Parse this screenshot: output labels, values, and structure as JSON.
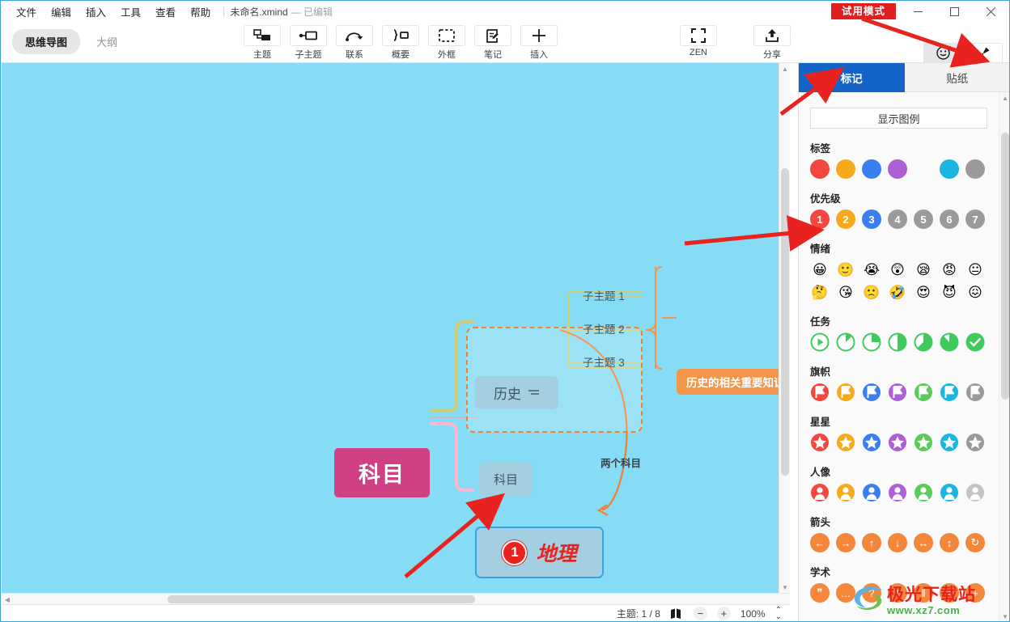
{
  "window": {
    "title": "未命名.xmind",
    "edited_state": "— 已编辑",
    "trial_badge": "试用模式",
    "minimize": "—",
    "maximize": "▢",
    "close": "✕"
  },
  "menubar": {
    "items": [
      {
        "label": "文件",
        "name": "menu-file"
      },
      {
        "label": "编辑",
        "name": "menu-edit"
      },
      {
        "label": "插入",
        "name": "menu-insert"
      },
      {
        "label": "工具",
        "name": "menu-tools"
      },
      {
        "label": "查看",
        "name": "menu-view"
      },
      {
        "label": "帮助",
        "name": "menu-help"
      }
    ]
  },
  "view_tabs": [
    {
      "label": "思维导图",
      "active": true
    },
    {
      "label": "大纲",
      "active": false
    }
  ],
  "toolbar": {
    "buttons": [
      {
        "label": "主题",
        "icon": "topic-icon"
      },
      {
        "label": "子主题",
        "icon": "subtopic-icon"
      },
      {
        "label": "联系",
        "icon": "relationship-icon"
      },
      {
        "label": "概要",
        "icon": "summary-icon"
      },
      {
        "label": "外框",
        "icon": "boundary-icon"
      },
      {
        "label": "笔记",
        "icon": "note-icon"
      },
      {
        "label": "插入",
        "icon": "plus-icon"
      }
    ],
    "zen": {
      "label": "ZEN",
      "icon": "fullscreen-icon"
    },
    "share": {
      "label": "分享",
      "icon": "share-icon"
    }
  },
  "panel_toggle": [
    {
      "label": "图标",
      "icon": "smiley-icon",
      "active": true
    },
    {
      "label": "格式",
      "icon": "brush-icon",
      "active": false
    }
  ],
  "canvas": {
    "root": "科目",
    "history_node": "历史",
    "history_note_icon": "note-lines-icon",
    "subtopics": [
      "子主题 1",
      "子主题 2",
      "子主题 3"
    ],
    "kemu_node": "科目",
    "geo_node": "地理",
    "geo_priority": "1",
    "callout": "历史的相关重要知识",
    "relationship_label": "两个科目"
  },
  "statusbar": {
    "topic_count": "主题: 1 / 8",
    "map_icon": "map-icon",
    "zoom_out": "−",
    "zoom_in": "+",
    "zoom_level": "100%",
    "zoom_stepper": "⌃⌄"
  },
  "right_panel": {
    "tabs": [
      {
        "label": "标记",
        "active": true
      },
      {
        "label": "贴纸",
        "active": false
      }
    ],
    "legend_button": "显示图例",
    "sections": [
      {
        "title": "标签",
        "kind": "dot",
        "items": [
          {
            "name": "label-red",
            "color": "#f4473f",
            "glyph": ""
          },
          {
            "name": "label-orange",
            "color": "#f5a91b",
            "glyph": ""
          },
          {
            "name": "label-blue",
            "color": "#3a7ff0",
            "glyph": ""
          },
          {
            "name": "label-purple",
            "color": "#ad5fd6",
            "glyph": ""
          },
          {
            "name": "label-green",
            "color": "#3cc койот",
            "glyph": ""
          },
          {
            "name": "label-cyan",
            "color": "#1ab6e0",
            "glyph": ""
          },
          {
            "name": "label-gray",
            "color": "#9a9a9a",
            "glyph": ""
          }
        ]
      },
      {
        "title": "优先级",
        "kind": "num",
        "items": [
          {
            "name": "priority-1",
            "color": "#f4473f",
            "glyph": "1"
          },
          {
            "name": "priority-2",
            "color": "#f5a91b",
            "glyph": "2"
          },
          {
            "name": "priority-3",
            "color": "#3a7ff0",
            "glyph": "3"
          },
          {
            "name": "priority-4",
            "color": "#9a9a9a",
            "glyph": "4"
          },
          {
            "name": "priority-5",
            "color": "#9a9a9a",
            "glyph": "5"
          },
          {
            "name": "priority-6",
            "color": "#9a9a9a",
            "glyph": "6"
          },
          {
            "name": "priority-7",
            "color": "#9a9a9a",
            "glyph": "7"
          }
        ]
      },
      {
        "title": "情绪",
        "kind": "emoji",
        "items": [
          {
            "name": "smiley-laugh",
            "color": "transparent",
            "glyph": "😀"
          },
          {
            "name": "smiley-smile",
            "color": "transparent",
            "glyph": "🙂"
          },
          {
            "name": "smiley-cry",
            "color": "transparent",
            "glyph": "😭"
          },
          {
            "name": "smiley-surprise",
            "color": "transparent",
            "glyph": "😲"
          },
          {
            "name": "smiley-sleepy",
            "color": "transparent",
            "glyph": "😪"
          },
          {
            "name": "smiley-angry",
            "color": "transparent",
            "glyph": "😡"
          },
          {
            "name": "smiley-neutral",
            "color": "transparent",
            "glyph": "😐"
          },
          {
            "name": "smiley-thinking",
            "color": "transparent",
            "glyph": "🤔"
          },
          {
            "name": "smiley-kiss",
            "color": "transparent",
            "glyph": "😘"
          },
          {
            "name": "smiley-sad",
            "color": "transparent",
            "glyph": "🙁"
          },
          {
            "name": "smiley-rofl",
            "color": "transparent",
            "glyph": "🤣"
          },
          {
            "name": "smiley-love",
            "color": "transparent",
            "glyph": "😍"
          },
          {
            "name": "smiley-devil",
            "color": "transparent",
            "glyph": "😈"
          },
          {
            "name": "smiley-persevere",
            "color": "transparent",
            "glyph": "😖"
          }
        ]
      },
      {
        "title": "任务",
        "kind": "task",
        "items": [
          {
            "name": "task-start",
            "color": "#3ecb5b",
            "pct": 0
          },
          {
            "name": "task-one-eighth",
            "color": "#3ecb5b",
            "pct": 13
          },
          {
            "name": "task-quarter",
            "color": "#3ecb5b",
            "pct": 25
          },
          {
            "name": "task-half",
            "color": "#3ecb5b",
            "pct": 50
          },
          {
            "name": "task-five-eighth",
            "color": "#3ecb5b",
            "pct": 63
          },
          {
            "name": "task-seven-eighth",
            "color": "#3ecb5b",
            "pct": 88
          },
          {
            "name": "task-done",
            "color": "#3ecb5b",
            "pct": 100
          }
        ]
      },
      {
        "title": "旗帜",
        "kind": "flag",
        "items": [
          {
            "name": "flag-red",
            "color": "#f4473f",
            "glyph": "⚑"
          },
          {
            "name": "flag-orange",
            "color": "#f5a91b",
            "glyph": "⚑"
          },
          {
            "name": "flag-blue",
            "color": "#3a7ff0",
            "glyph": "⚑"
          },
          {
            "name": "flag-purple",
            "color": "#ad5fd6",
            "glyph": "⚑"
          },
          {
            "name": "flag-green",
            "color": "#5ccb5b",
            "glyph": "⚑"
          },
          {
            "name": "flag-cyan",
            "color": "#1ab6e0",
            "glyph": "⚑"
          },
          {
            "name": "flag-gray",
            "color": "#9a9a9a",
            "glyph": "⚑"
          }
        ]
      },
      {
        "title": "星星",
        "kind": "star",
        "items": [
          {
            "name": "star-red",
            "color": "#f4473f",
            "glyph": "★"
          },
          {
            "name": "star-orange",
            "color": "#f5a91b",
            "glyph": "★"
          },
          {
            "name": "star-blue",
            "color": "#3a7ff0",
            "glyph": "★"
          },
          {
            "name": "star-purple",
            "color": "#ad5fd6",
            "glyph": "★"
          },
          {
            "name": "star-green",
            "color": "#5ccb5b",
            "glyph": "★"
          },
          {
            "name": "star-cyan",
            "color": "#1ab6e0",
            "glyph": "★"
          },
          {
            "name": "star-gray",
            "color": "#9a9a9a",
            "glyph": "★"
          }
        ]
      },
      {
        "title": "人像",
        "kind": "person",
        "items": [
          {
            "name": "person-red",
            "color": "#f4473f",
            "glyph": "👤"
          },
          {
            "name": "person-orange",
            "color": "#f5a91b",
            "glyph": "👤"
          },
          {
            "name": "person-blue",
            "color": "#3a7ff0",
            "glyph": "👤"
          },
          {
            "name": "person-purple",
            "color": "#ad5fd6",
            "glyph": "👤"
          },
          {
            "name": "person-green",
            "color": "#5ccb5b",
            "glyph": "👤"
          },
          {
            "name": "person-cyan",
            "color": "#1ab6e0",
            "glyph": "👤"
          },
          {
            "name": "person-gray",
            "color": "#c4c4c4",
            "glyph": "👤"
          }
        ]
      },
      {
        "title": "箭头",
        "kind": "arrow",
        "items": [
          {
            "name": "arrow-left",
            "color": "#f4873b",
            "glyph": "←"
          },
          {
            "name": "arrow-right",
            "color": "#f4873b",
            "glyph": "→"
          },
          {
            "name": "arrow-up",
            "color": "#f4873b",
            "glyph": "↑"
          },
          {
            "name": "arrow-down",
            "color": "#f4873b",
            "glyph": "↓"
          },
          {
            "name": "arrow-left-right",
            "color": "#f4873b",
            "glyph": "↔"
          },
          {
            "name": "arrow-up-down",
            "color": "#f4873b",
            "glyph": "↕"
          },
          {
            "name": "arrow-refresh",
            "color": "#f4873b",
            "glyph": "↻"
          }
        ]
      },
      {
        "title": "学术",
        "kind": "acad",
        "items": [
          {
            "name": "acad-quote",
            "color": "#f4873b",
            "glyph": "❞"
          },
          {
            "name": "acad-ellipsis",
            "color": "#f4873b",
            "glyph": "…"
          },
          {
            "name": "acad-question",
            "color": "#f4873b",
            "glyph": "?"
          },
          {
            "name": "acad-exclamation",
            "color": "#f4873b",
            "glyph": "!"
          },
          {
            "name": "acad-pause",
            "color": "#f4873b",
            "glyph": "‖"
          },
          {
            "name": "acad-info",
            "color": "#f4873b",
            "glyph": "i"
          },
          {
            "name": "acad-plus",
            "color": "#f4873b",
            "glyph": "+"
          }
        ]
      }
    ]
  },
  "watermark": {
    "text": "极光下载站",
    "sub": "www.xz7.com"
  },
  "colors": {
    "accent_blue": "#1464c8",
    "trial_red": "#e02020",
    "canvas_bg": "#87dcf5",
    "root_node": "#cf4183",
    "callout_orange": "#f2964a",
    "boundary_orange": "#f2802c",
    "annotation_red": "#e8231f"
  }
}
